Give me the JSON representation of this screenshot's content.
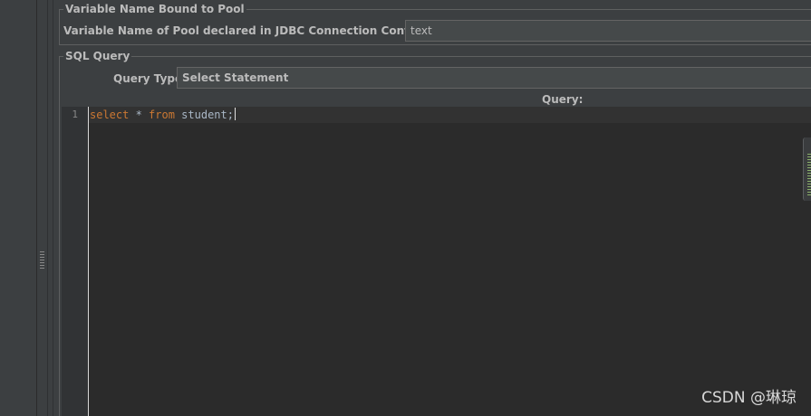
{
  "pool_section": {
    "title": "Variable Name Bound to Pool",
    "label": "Variable Name of Pool declared in JDBC Connection Configuration:",
    "value": "text"
  },
  "sql_section": {
    "title": "SQL Query",
    "query_type_label": "Query Type:",
    "query_type_value": "Select Statement",
    "query_header": "Query:"
  },
  "editor": {
    "line_number": "1",
    "tokens": [
      {
        "text": "select",
        "kind": "keyword"
      },
      {
        "text": " * ",
        "kind": "plain"
      },
      {
        "text": "from",
        "kind": "keyword"
      },
      {
        "text": " student;",
        "kind": "plain"
      }
    ]
  },
  "watermark": "CSDN @琳琼",
  "colors": {
    "background": "#3c3f41",
    "editor_bg": "#2b2b2b",
    "keyword": "#cc7832",
    "plain_code": "#a9b7c6"
  }
}
